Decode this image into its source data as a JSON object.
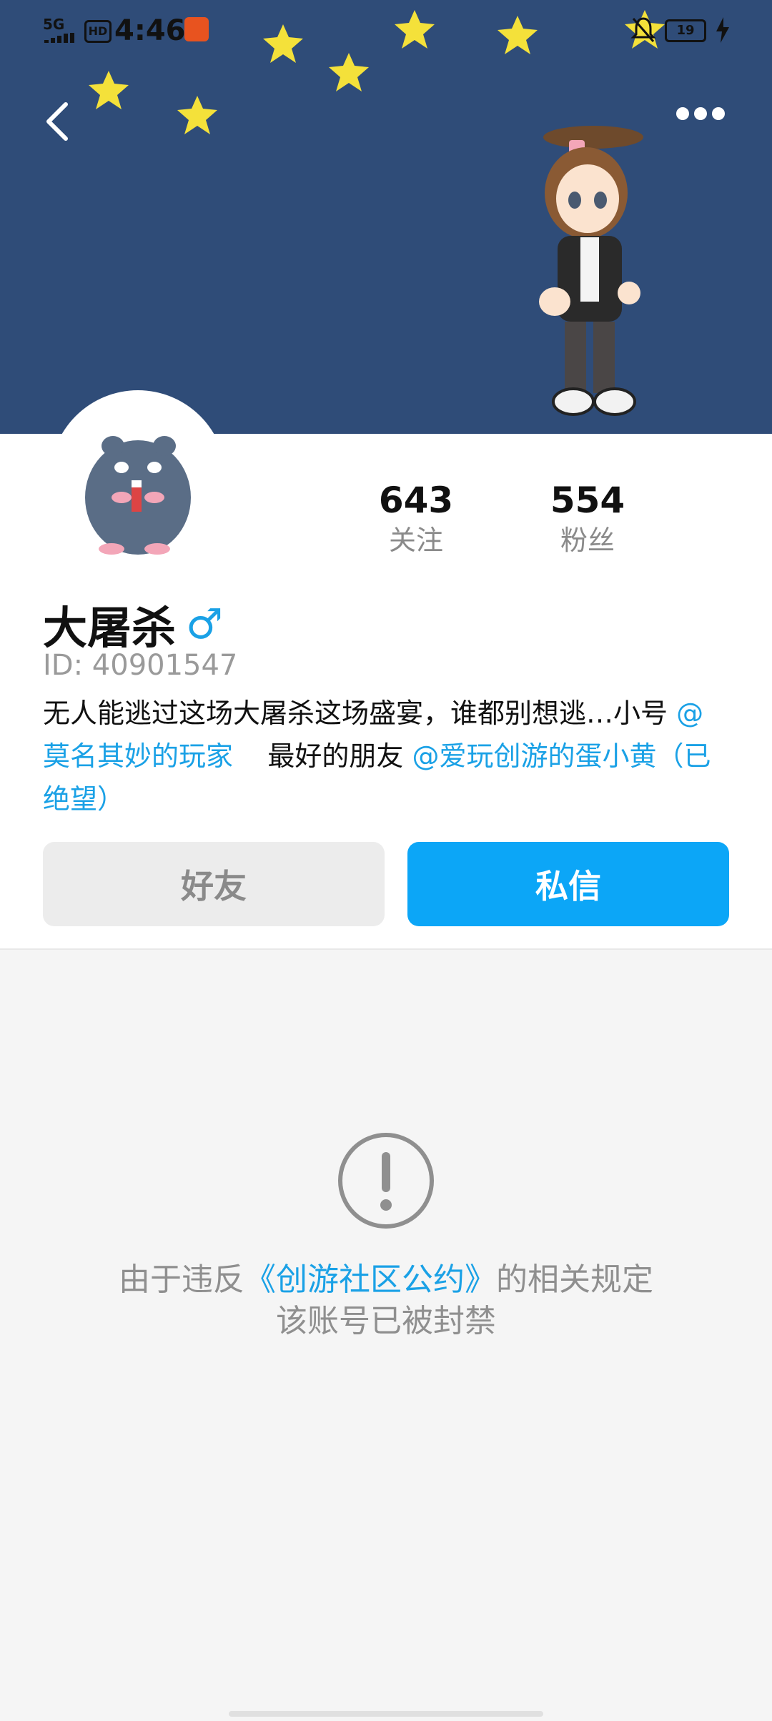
{
  "status_bar": {
    "network": "5G",
    "hd": "HD",
    "time": "4:46",
    "battery": "19"
  },
  "colors": {
    "banner": "#2f4c78",
    "accent": "#1aa1e6",
    "button_primary": "#0ca6f7",
    "button_secondary": "#ececec"
  },
  "icons": {
    "back": "chevron-left-icon",
    "more": "more-dots-icon",
    "gender": "male-icon",
    "notice": "exclamation-circle-icon"
  },
  "profile": {
    "following_count": "643",
    "following_label": "关注",
    "followers_count": "554",
    "followers_label": "粉丝",
    "name": "大屠杀",
    "gender_symbol": "♂",
    "id_text": "ID: 40901547",
    "bio_text": "无人能逃过这场大屠杀这场盛宴，谁都别想逃…小号",
    "bio_mention_1": "@莫名其妙的玩家",
    "bio_middle": "最好的朋友",
    "bio_mention_2": "@爱玩创游的蛋小黄（已绝望）"
  },
  "actions": {
    "friend_label": "好友",
    "message_label": "私信"
  },
  "ban_notice": {
    "prefix": "由于违反",
    "link": "《创游社区公约》",
    "suffix": "的相关规定",
    "line2": "该账号已被封禁"
  }
}
